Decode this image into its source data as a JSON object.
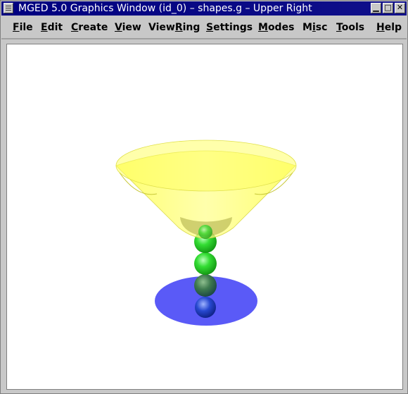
{
  "window": {
    "title": "MGED 5.0 Graphics Window (id_0) – shapes.g – Upper Right",
    "controls": {
      "minimize": "▁",
      "maximize": "□",
      "close": "✕"
    }
  },
  "menubar": {
    "items": [
      {
        "key": "file",
        "pre": "",
        "mnemonic": "F",
        "post": "ile"
      },
      {
        "key": "edit",
        "pre": "",
        "mnemonic": "E",
        "post": "dit"
      },
      {
        "key": "create",
        "pre": "",
        "mnemonic": "C",
        "post": "reate"
      },
      {
        "key": "view",
        "pre": "",
        "mnemonic": "V",
        "post": "iew"
      },
      {
        "key": "viewring",
        "pre": "View",
        "mnemonic": "R",
        "post": "ing"
      },
      {
        "key": "settings",
        "pre": "",
        "mnemonic": "S",
        "post": "ettings"
      },
      {
        "key": "modes",
        "pre": "",
        "mnemonic": "M",
        "post": "odes"
      },
      {
        "key": "misc",
        "pre": "M",
        "mnemonic": "i",
        "post": "sc"
      },
      {
        "key": "tools",
        "pre": "",
        "mnemonic": "T",
        "post": "ools"
      },
      {
        "key": "help",
        "pre": "",
        "mnemonic": "H",
        "post": "elp"
      }
    ]
  },
  "scene": {
    "shapes": [
      "cone-bowl",
      "sphere-1",
      "sphere-2",
      "sphere-3",
      "sphere-4",
      "base-disc"
    ],
    "colors": {
      "cone": "#ffff66",
      "cone_edge": "#d8d84a",
      "spheres_upper": "#33dd33",
      "spheres_lower": "#2244cc",
      "base": "#5555ff"
    }
  }
}
